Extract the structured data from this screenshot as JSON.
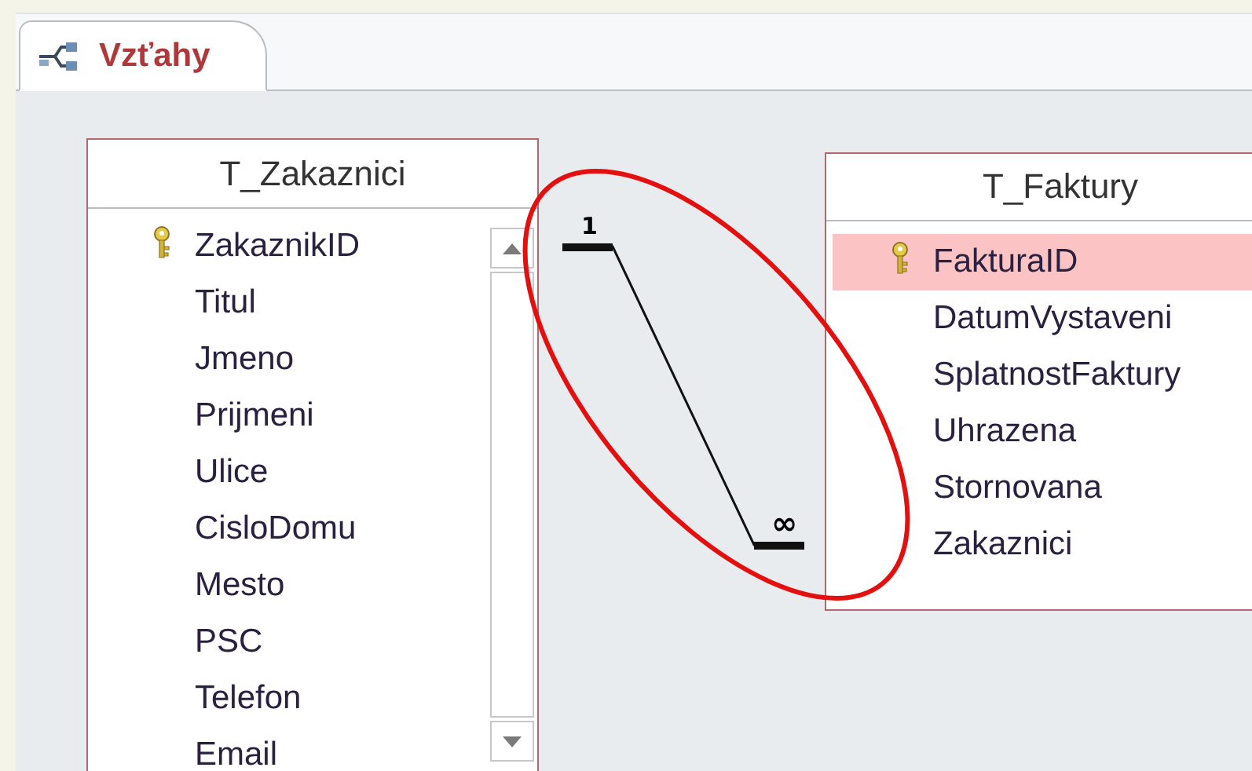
{
  "tabs": [
    {
      "label": "Vzťahy",
      "selected": true
    }
  ],
  "tables": [
    {
      "title": "T_Zakaznici",
      "scrollbar": true,
      "fields": [
        {
          "name": "ZakaznikID",
          "key": true,
          "selected": false
        },
        {
          "name": "Titul",
          "key": false,
          "selected": false
        },
        {
          "name": "Jmeno",
          "key": false,
          "selected": false
        },
        {
          "name": "Prijmeni",
          "key": false,
          "selected": false
        },
        {
          "name": "Ulice",
          "key": false,
          "selected": false
        },
        {
          "name": "CisloDomu",
          "key": false,
          "selected": false
        },
        {
          "name": "Mesto",
          "key": false,
          "selected": false
        },
        {
          "name": "PSC",
          "key": false,
          "selected": false
        },
        {
          "name": "Telefon",
          "key": false,
          "selected": false
        },
        {
          "name": "Email",
          "key": false,
          "selected": false
        }
      ]
    },
    {
      "title": "T_Faktury",
      "scrollbar": false,
      "fields": [
        {
          "name": "FakturaID",
          "key": true,
          "selected": true
        },
        {
          "name": "DatumVystaveni",
          "key": false,
          "selected": false
        },
        {
          "name": "SplatnostFaktury",
          "key": false,
          "selected": false
        },
        {
          "name": "Uhrazena",
          "key": false,
          "selected": false
        },
        {
          "name": "Stornovana",
          "key": false,
          "selected": false
        },
        {
          "name": "Zakaznici",
          "key": false,
          "selected": false
        }
      ]
    }
  ],
  "relationship": {
    "from_label": "1",
    "to_label": "∞",
    "highlighted": true
  }
}
